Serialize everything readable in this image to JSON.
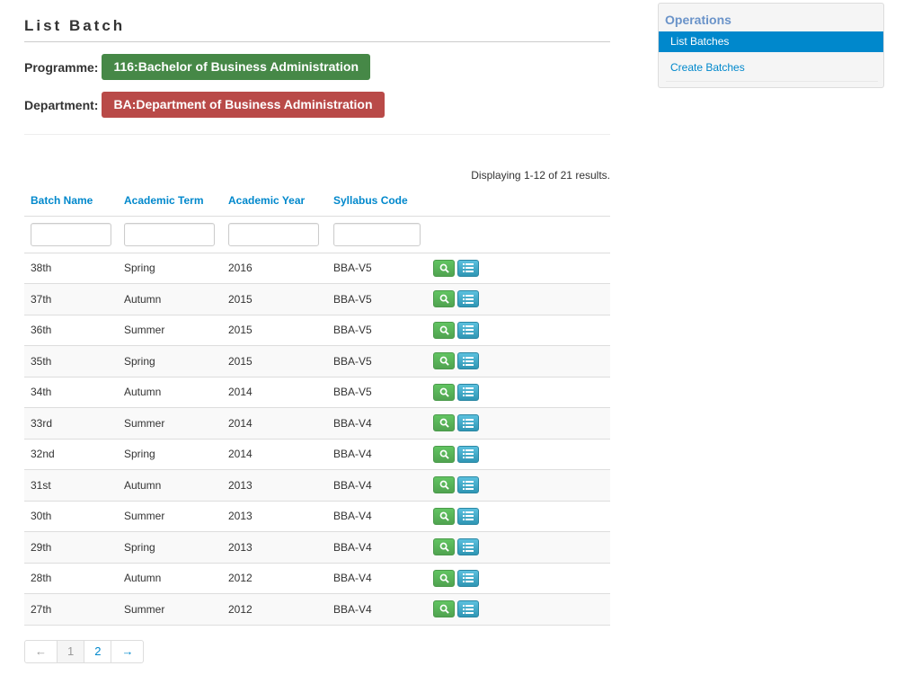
{
  "page": {
    "title": "List Batch",
    "programme_label": "Programme:",
    "programme_value": "116:Bachelor of Business Administration",
    "department_label": "Department:",
    "department_value": "BA:Department of Business Administration",
    "summary": "Displaying 1-12 of 21 results."
  },
  "table": {
    "columns": [
      "Batch Name",
      "Academic Term",
      "Academic Year",
      "Syllabus Code"
    ],
    "rows": [
      [
        "38th",
        "Spring",
        "2016",
        "BBA-V5"
      ],
      [
        "37th",
        "Autumn",
        "2015",
        "BBA-V5"
      ],
      [
        "36th",
        "Summer",
        "2015",
        "BBA-V5"
      ],
      [
        "35th",
        "Spring",
        "2015",
        "BBA-V5"
      ],
      [
        "34th",
        "Autumn",
        "2014",
        "BBA-V5"
      ],
      [
        "33rd",
        "Summer",
        "2014",
        "BBA-V4"
      ],
      [
        "32nd",
        "Spring",
        "2014",
        "BBA-V4"
      ],
      [
        "31st",
        "Autumn",
        "2013",
        "BBA-V4"
      ],
      [
        "30th",
        "Summer",
        "2013",
        "BBA-V4"
      ],
      [
        "29th",
        "Spring",
        "2013",
        "BBA-V4"
      ],
      [
        "28th",
        "Autumn",
        "2012",
        "BBA-V4"
      ],
      [
        "27th",
        "Summer",
        "2012",
        "BBA-V4"
      ]
    ],
    "row_actions": [
      "search-icon",
      "list-icon"
    ]
  },
  "pager": {
    "prev": "←",
    "pages": [
      "1",
      "2"
    ],
    "current": "1",
    "next": "→"
  },
  "sidebar": {
    "title": "Operations",
    "items": [
      {
        "label": "List Batches",
        "active": true
      },
      {
        "label": "Create Batches",
        "active": false
      }
    ]
  },
  "colors": {
    "link": "#0088cc",
    "programme_badge": "#468847",
    "department_badge": "#b94a48",
    "view_button": "#5bb75b",
    "list_button": "#49afcd"
  }
}
